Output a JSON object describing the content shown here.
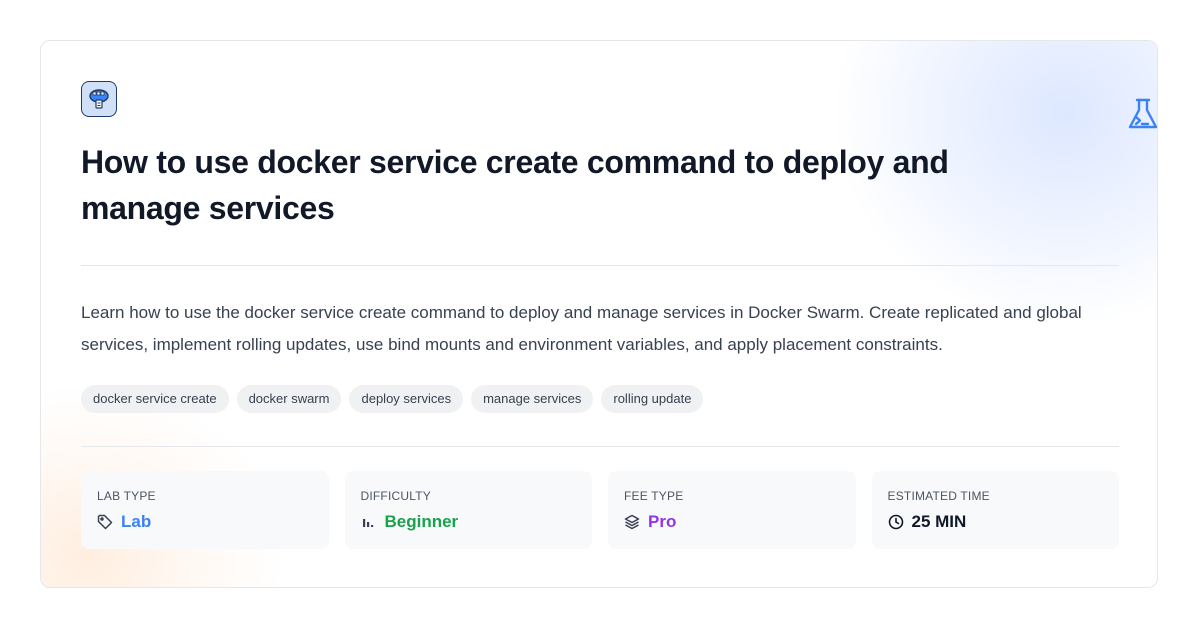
{
  "course": {
    "title": "How to use docker service create command to deploy and manage services",
    "description": "Learn how to use the docker service create command to deploy and manage services in Docker Swarm. Create replicated and global services, implement rolling updates, use bind mounts and environment variables, and apply placement constraints.",
    "logo_icon": "docker-icon",
    "corner_icon": "flask-terminal-icon",
    "tags": [
      {
        "label": "docker service create"
      },
      {
        "label": "docker swarm"
      },
      {
        "label": "deploy services"
      },
      {
        "label": "manage services"
      },
      {
        "label": "rolling update"
      }
    ]
  },
  "stats": {
    "lab_type": {
      "label": "LAB TYPE",
      "value": "Lab",
      "icon": "tag-icon",
      "color": "#3b82f6"
    },
    "difficulty": {
      "label": "DIFFICULTY",
      "value": "Beginner",
      "icon": "bar-chart-icon",
      "color": "#16a34a"
    },
    "fee_type": {
      "label": "FEE TYPE",
      "value": "Pro",
      "icon": "layers-icon",
      "color": "#9333ea"
    },
    "estimated_time": {
      "label": "ESTIMATED TIME",
      "value": "25 MIN",
      "icon": "clock-icon",
      "color": "#111827"
    }
  },
  "colors": {
    "accent_blue": "#3b82f6",
    "title": "#111827",
    "text": "#374151"
  }
}
